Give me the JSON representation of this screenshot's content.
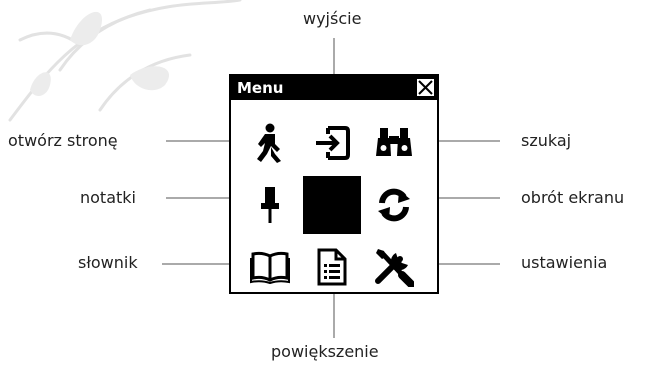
{
  "menu": {
    "title": "Menu",
    "items": {
      "open_page": {
        "label": "otwórz stronę",
        "icon": "walking-person-icon"
      },
      "exit": {
        "label": "wyjście",
        "icon": "exit-door-icon"
      },
      "search": {
        "label": "szukaj",
        "icon": "binoculars-icon"
      },
      "notes": {
        "label": "notatki",
        "icon": "pushpin-icon"
      },
      "current": {
        "label": "",
        "icon": "selected-cell"
      },
      "rotate": {
        "label": "obrót ekranu",
        "icon": "rotate-arrows-icon"
      },
      "dictionary": {
        "label": "słownik",
        "icon": "open-book-icon"
      },
      "zoom": {
        "label": "powiększenie",
        "icon": "document-icon"
      },
      "settings": {
        "label": "ustawienia",
        "icon": "wrench-screwdriver-icon"
      }
    },
    "close_icon": "close-x-icon"
  },
  "colors": {
    "ink": "#000000",
    "text": "#222222",
    "line": "#555555",
    "decor": "#dddddd",
    "background": "#ffffff"
  }
}
